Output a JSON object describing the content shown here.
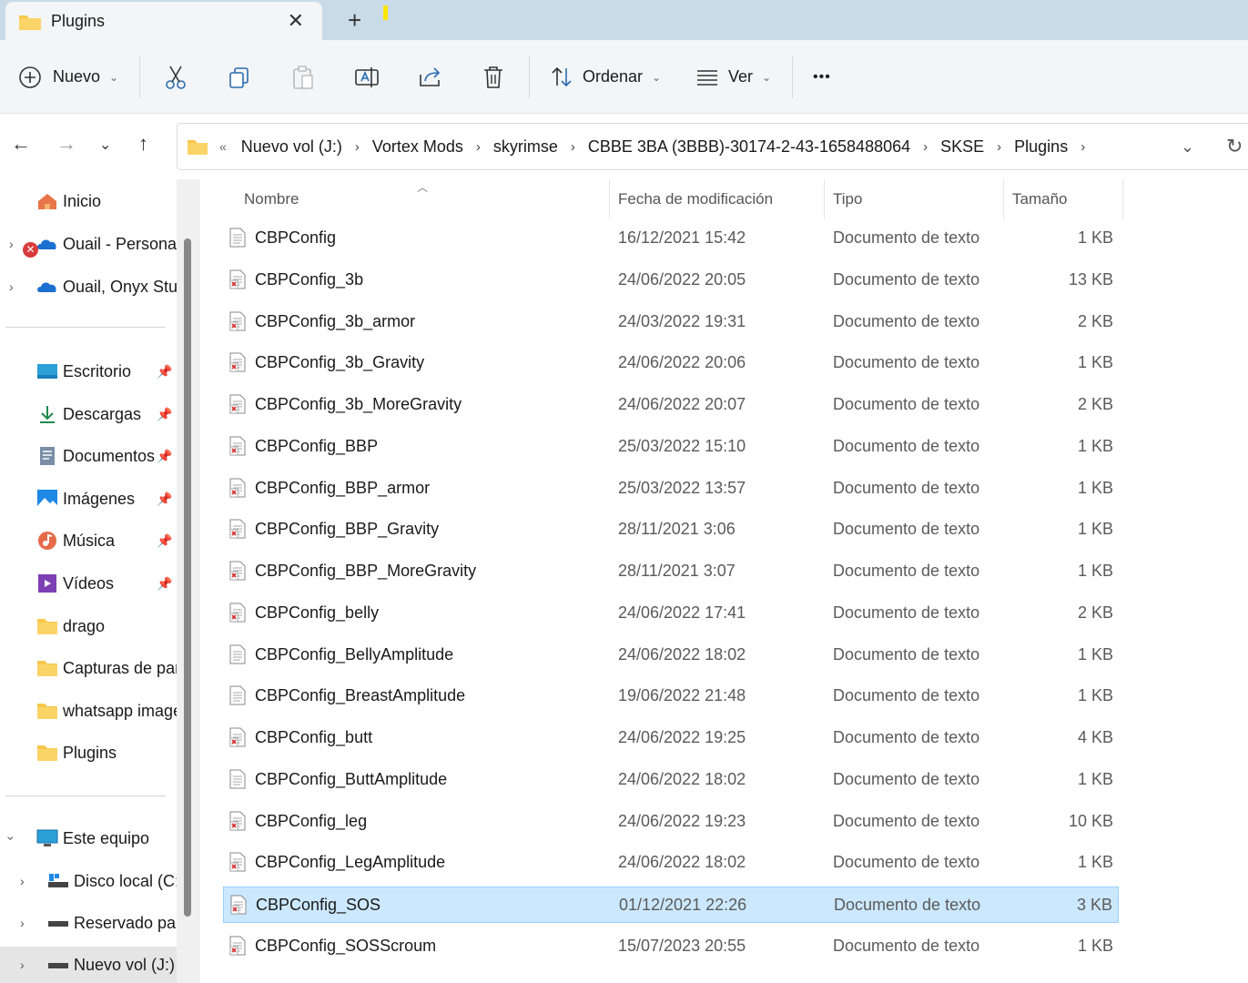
{
  "tab": {
    "title": "Plugins",
    "close": "✕",
    "new_tab": "+"
  },
  "toolbar": {
    "new_label": "Nuevo",
    "sort_label": "Ordenar",
    "view_label": "Ver",
    "more": "•••"
  },
  "address": {
    "overflow": "«",
    "crumbs": [
      "Nuevo vol (J:)",
      "Vortex Mods",
      "skyrimse",
      "CBBE 3BA (3BBB)-30174-2-43-1658488064",
      "SKSE",
      "Plugins"
    ],
    "separator": "›"
  },
  "sidebar": {
    "home": "Inicio",
    "cloud1": "Ouail - Personal",
    "cloud2": "Ouail, Onyx Studio",
    "quick": [
      {
        "label": "Escritorio",
        "icon": "desktop-icon"
      },
      {
        "label": "Descargas",
        "icon": "download-icon"
      },
      {
        "label": "Documentos",
        "icon": "documents-icon"
      },
      {
        "label": "Imágenes",
        "icon": "pictures-icon"
      },
      {
        "label": "Música",
        "icon": "music-icon"
      },
      {
        "label": "Vídeos",
        "icon": "videos-icon"
      },
      {
        "label": "drago",
        "icon": "folder-icon"
      },
      {
        "label": "Capturas de pantalla",
        "icon": "folder-icon"
      },
      {
        "label": "whatsapp images",
        "icon": "folder-icon"
      },
      {
        "label": "Plugins",
        "icon": "folder-icon"
      }
    ],
    "this_pc": "Este equipo",
    "drives": [
      "Disco local (C:)",
      "Reservado para el sistema",
      "Nuevo vol (J:)"
    ]
  },
  "columns": {
    "name": "Nombre",
    "date": "Fecha de modificación",
    "type": "Tipo",
    "size": "Tamaño"
  },
  "files": [
    {
      "name": "CBPConfig",
      "date": "16/12/2021 15:42",
      "type": "Documento de texto",
      "size": "1 KB",
      "icon": "text-file-icon"
    },
    {
      "name": "CBPConfig_3b",
      "date": "24/06/2022 20:05",
      "type": "Documento de texto",
      "size": "13 KB",
      "icon": "text-file-red-icon"
    },
    {
      "name": "CBPConfig_3b_armor",
      "date": "24/03/2022 19:31",
      "type": "Documento de texto",
      "size": "2 KB",
      "icon": "text-file-red-icon"
    },
    {
      "name": "CBPConfig_3b_Gravity",
      "date": "24/06/2022 20:06",
      "type": "Documento de texto",
      "size": "1 KB",
      "icon": "text-file-red-icon"
    },
    {
      "name": "CBPConfig_3b_MoreGravity",
      "date": "24/06/2022 20:07",
      "type": "Documento de texto",
      "size": "2 KB",
      "icon": "text-file-red-icon"
    },
    {
      "name": "CBPConfig_BBP",
      "date": "25/03/2022 15:10",
      "type": "Documento de texto",
      "size": "1 KB",
      "icon": "text-file-red-icon"
    },
    {
      "name": "CBPConfig_BBP_armor",
      "date": "25/03/2022 13:57",
      "type": "Documento de texto",
      "size": "1 KB",
      "icon": "text-file-red-icon"
    },
    {
      "name": "CBPConfig_BBP_Gravity",
      "date": "28/11/2021 3:06",
      "type": "Documento de texto",
      "size": "1 KB",
      "icon": "text-file-red-icon"
    },
    {
      "name": "CBPConfig_BBP_MoreGravity",
      "date": "28/11/2021 3:07",
      "type": "Documento de texto",
      "size": "1 KB",
      "icon": "text-file-red-icon"
    },
    {
      "name": "CBPConfig_belly",
      "date": "24/06/2022 17:41",
      "type": "Documento de texto",
      "size": "2 KB",
      "icon": "text-file-red-icon"
    },
    {
      "name": "CBPConfig_BellyAmplitude",
      "date": "24/06/2022 18:02",
      "type": "Documento de texto",
      "size": "1 KB",
      "icon": "text-file-icon"
    },
    {
      "name": "CBPConfig_BreastAmplitude",
      "date": "19/06/2022 21:48",
      "type": "Documento de texto",
      "size": "1 KB",
      "icon": "text-file-icon"
    },
    {
      "name": "CBPConfig_butt",
      "date": "24/06/2022 19:25",
      "type": "Documento de texto",
      "size": "4 KB",
      "icon": "text-file-red-icon"
    },
    {
      "name": "CBPConfig_ButtAmplitude",
      "date": "24/06/2022 18:02",
      "type": "Documento de texto",
      "size": "1 KB",
      "icon": "text-file-icon"
    },
    {
      "name": "CBPConfig_leg",
      "date": "24/06/2022 19:23",
      "type": "Documento de texto",
      "size": "10 KB",
      "icon": "text-file-red-icon"
    },
    {
      "name": "CBPConfig_LegAmplitude",
      "date": "24/06/2022 18:02",
      "type": "Documento de texto",
      "size": "1 KB",
      "icon": "text-file-red-icon"
    },
    {
      "name": "CBPConfig_SOS",
      "date": "01/12/2021 22:26",
      "type": "Documento de texto",
      "size": "3 KB",
      "icon": "text-file-red-icon",
      "selected": true
    },
    {
      "name": "CBPConfig_SOSScroum",
      "date": "15/07/2023 20:55",
      "type": "Documento de texto",
      "size": "1 KB",
      "icon": "text-file-red-icon"
    }
  ],
  "colors": {
    "selection": "#cce8ff",
    "selection_border": "#99d1ff",
    "tabbar": "#c9dbe6",
    "folder": "#f8c74a"
  }
}
